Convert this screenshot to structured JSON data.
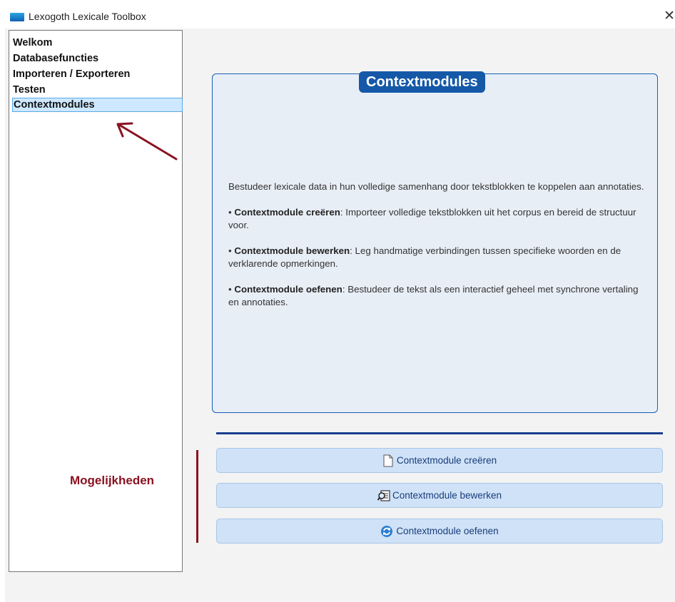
{
  "window": {
    "title": "Lexogoth Lexicale Toolbox",
    "close_glyph": "✕"
  },
  "sidebar": {
    "items": [
      {
        "label": "Welkom"
      },
      {
        "label": "Databasefuncties"
      },
      {
        "label": "Importeren / Exporteren"
      },
      {
        "label": "Testen"
      },
      {
        "label": "Contextmodules",
        "selected": true
      }
    ]
  },
  "annotation": {
    "options_label": "Mogelijkheden",
    "color": "#8a1222"
  },
  "content": {
    "heading": "Contextmodules",
    "intro": "Bestudeer lexicale data in hun volledige samenhang door tekstblokken te koppelen aan annotaties.",
    "bullets": [
      {
        "prefix": "• ",
        "term": "Contextmodule creëren",
        "text": ": Importeer volledige tekstblokken uit het corpus en bereid de structuur voor."
      },
      {
        "prefix": "• ",
        "term": "Contextmodule bewerken",
        "text": ": Leg handmatige verbindingen tussen specifieke woorden en de verklarende opmerkingen."
      },
      {
        "prefix": "• ",
        "term": "Contextmodule oefenen",
        "text": ": Bestudeer de tekst als een interactief geheel met synchrone vertaling en annotaties."
      }
    ]
  },
  "actions": {
    "create": {
      "label": "Contextmodule creëren",
      "icon": "new-document-icon"
    },
    "edit": {
      "label": "Contextmodule bewerken",
      "icon": "search-document-icon"
    },
    "practice": {
      "label": "Contextmodule oefenen",
      "icon": "refresh-icon"
    }
  },
  "colors": {
    "accent": "#1558a8",
    "button_bg": "#cfe2f7",
    "selection": "#cde8ff"
  }
}
